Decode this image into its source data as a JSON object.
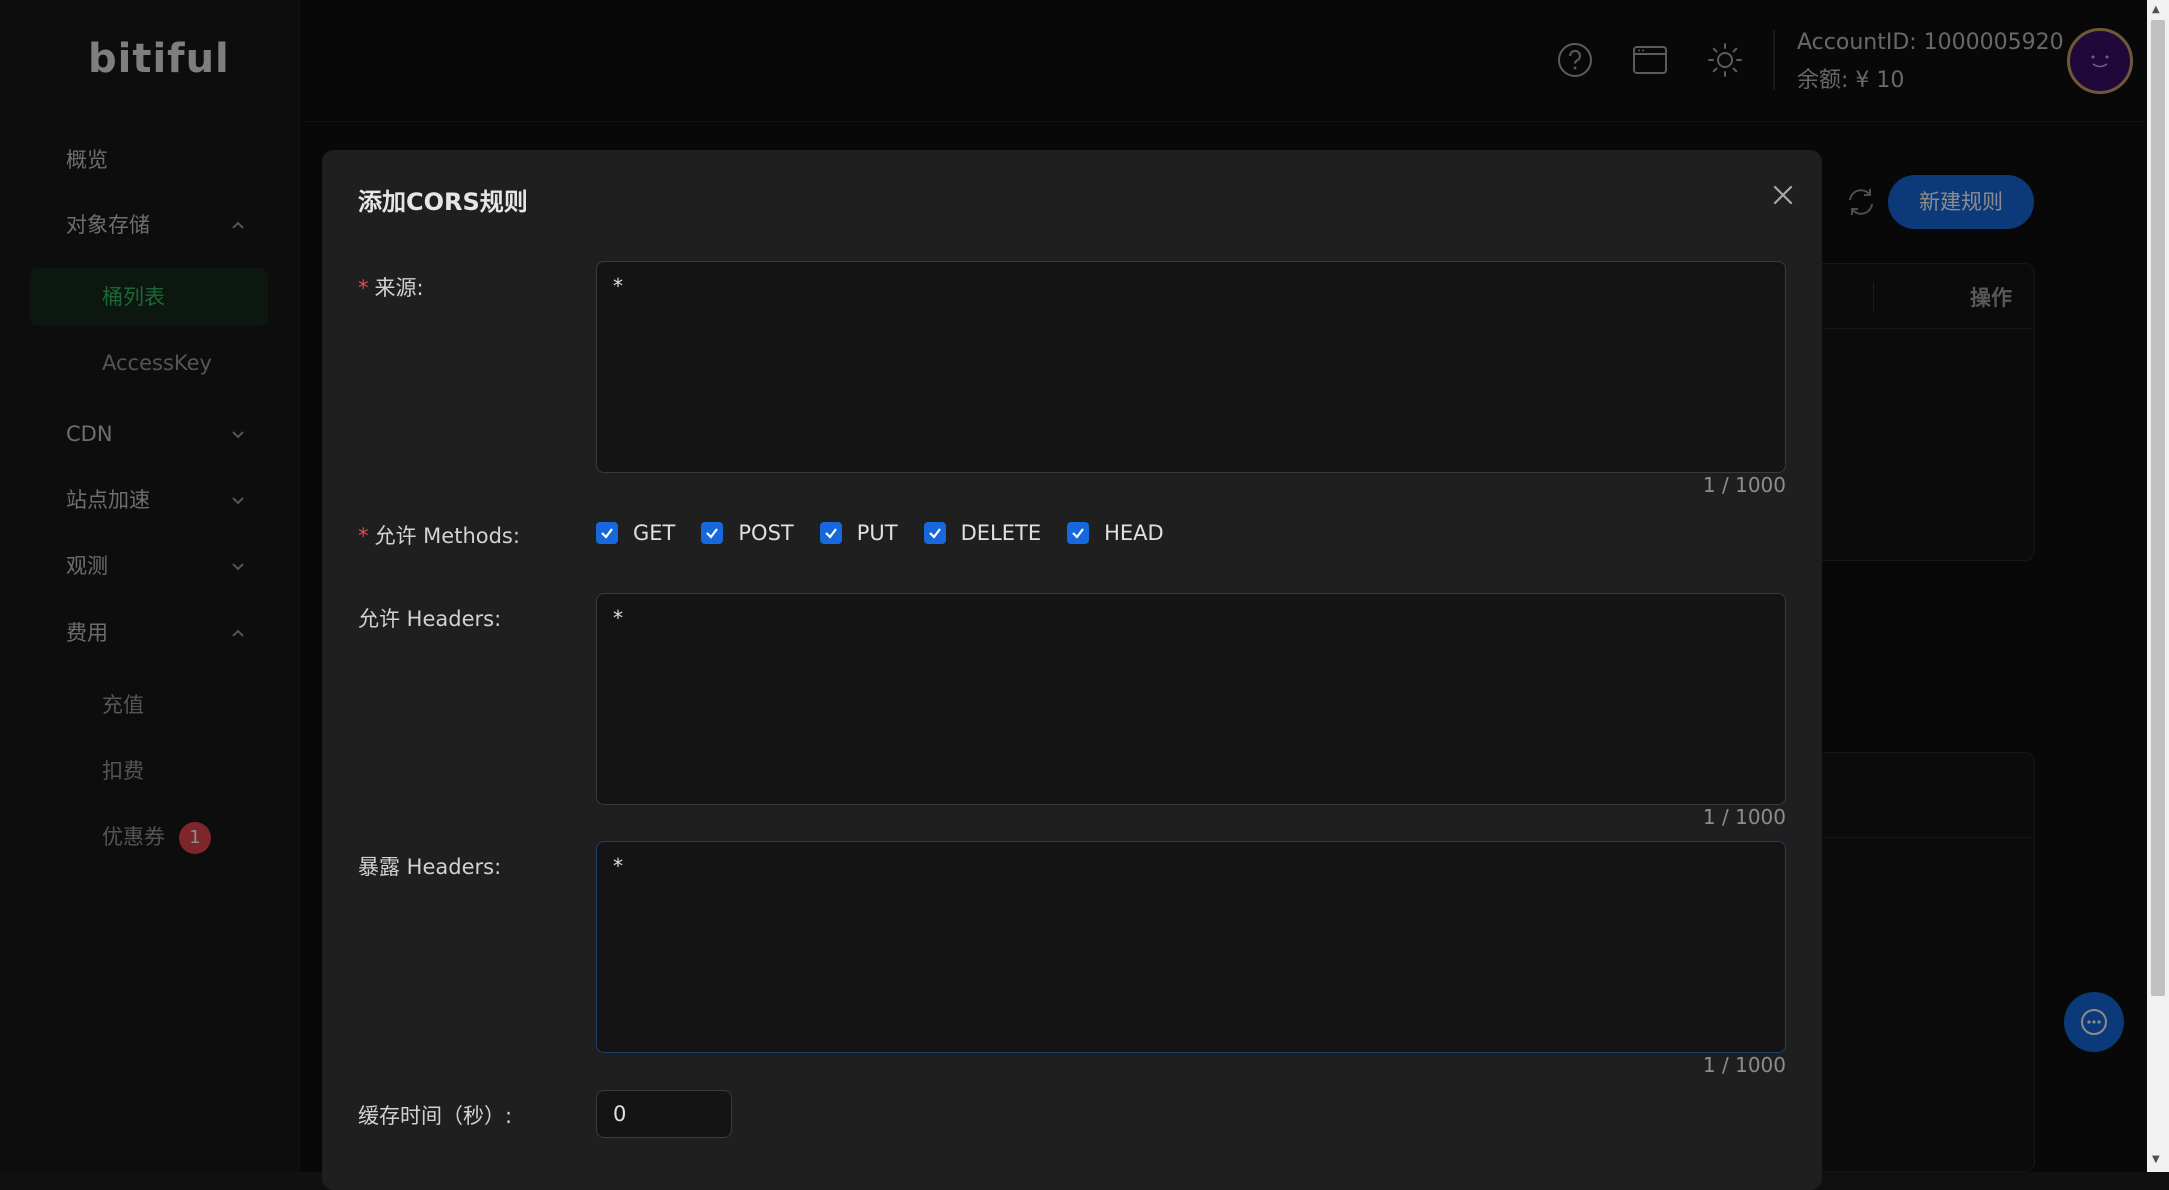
{
  "sidebar": {
    "logo": "bitiful",
    "items": {
      "overview": "概览",
      "object_storage": "对象存储",
      "bucket_list": "桶列表",
      "access_key": "AccessKey",
      "cdn": "CDN",
      "site_accel": "站点加速",
      "observe": "观测",
      "billing": "费用",
      "recharge": "充值",
      "deduct": "扣费",
      "coupons": "优惠券",
      "coupons_badge": "1"
    },
    "chevron_up": "⌃",
    "chevron_down": "⌄"
  },
  "header": {
    "account_id": "AccountID: 1000005920",
    "balance": "余额: ¥ 10"
  },
  "page": {
    "new_rule_button": "新建规则",
    "ops_column": "操作"
  },
  "modal": {
    "title": "添加CORS规则",
    "close_glyph": "×",
    "origin": {
      "label": "来源:",
      "value": "*",
      "counter": "1 / 1000"
    },
    "methods": {
      "label": "允许 Methods:",
      "options": [
        "GET",
        "POST",
        "PUT",
        "DELETE",
        "HEAD"
      ]
    },
    "allow_headers": {
      "label": "允许 Headers:",
      "value": "*",
      "counter": "1 / 1000"
    },
    "expose_headers": {
      "label": "暴露 Headers:",
      "value": "*",
      "counter": "1 / 1000"
    },
    "cache": {
      "label": "缓存时间（秒）:",
      "value": "0"
    },
    "required_mark": "*"
  },
  "colors": {
    "accent": "#1668dc",
    "active_nav": "#2fbf62",
    "danger": "#e5484d"
  }
}
